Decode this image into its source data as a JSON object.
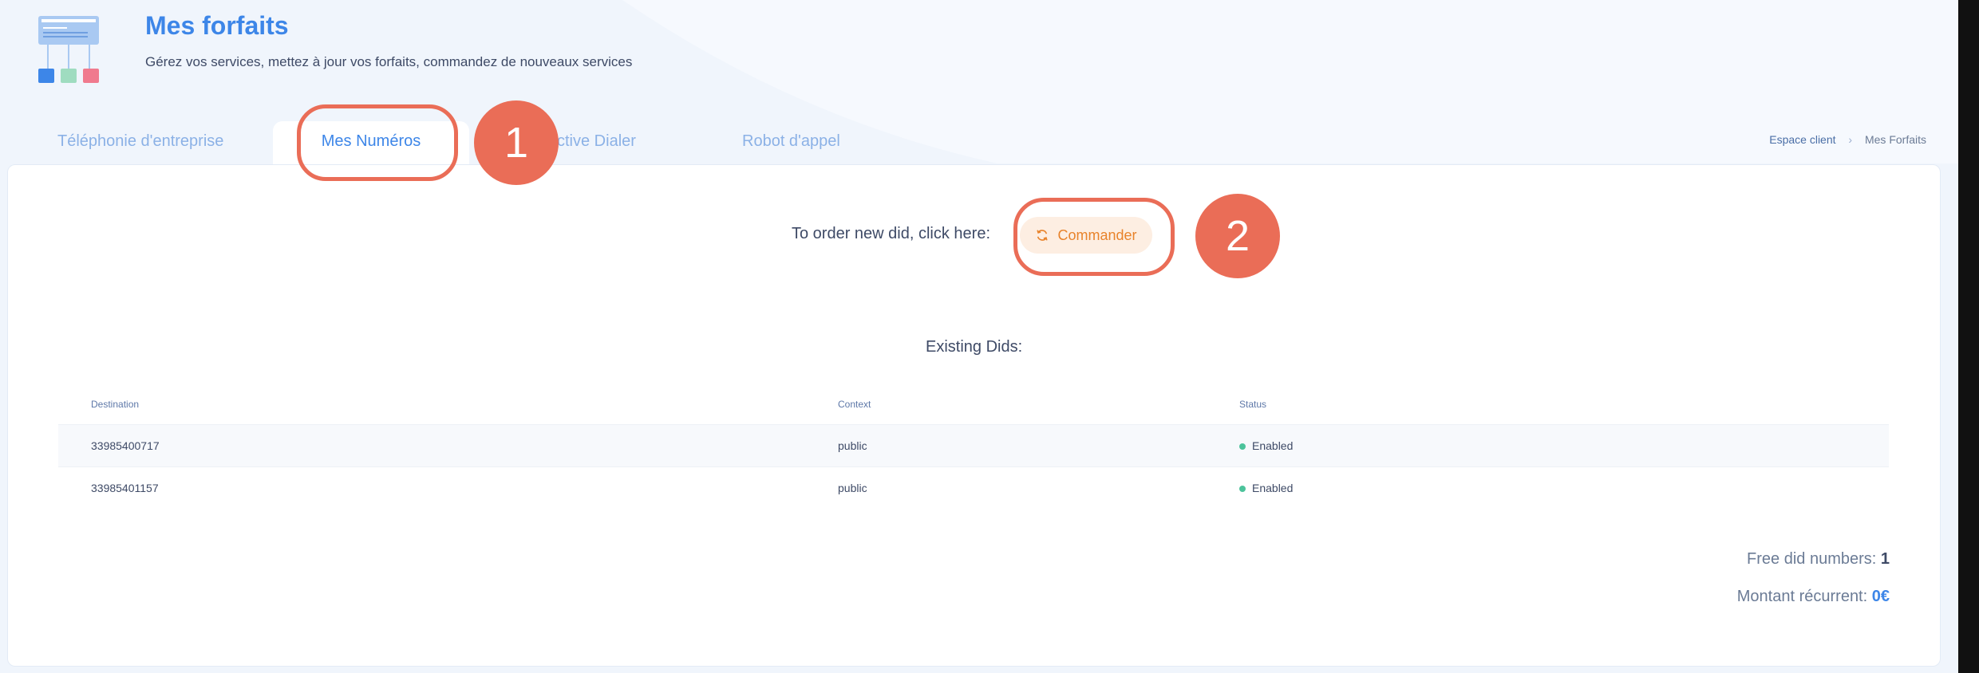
{
  "header": {
    "title": "Mes forfaits",
    "subtitle": "Gérez vos services, mettez à jour vos forfaits, commandez de nouveaux services"
  },
  "tabs": [
    {
      "label": "Téléphonie d'entreprise",
      "active": false
    },
    {
      "label": "Mes Numéros",
      "active": true
    },
    {
      "label": "Predictive Dialer",
      "active": false
    },
    {
      "label": "Robot d'appel",
      "active": false
    }
  ],
  "tab_partial_label": "ctive Dialer",
  "breadcrumb": {
    "home": "Espace client",
    "separator": "›",
    "current": "Mes Forfaits"
  },
  "order": {
    "prompt": "To order new did, click here:",
    "button_label": "Commander"
  },
  "existing_title": "Existing Dids:",
  "table": {
    "headers": [
      "Destination",
      "Context",
      "Status"
    ],
    "rows": [
      {
        "destination": "33985400717",
        "context": "public",
        "status": "Enabled"
      },
      {
        "destination": "33985401157",
        "context": "public",
        "status": "Enabled"
      }
    ]
  },
  "summary": {
    "free_label": "Free did numbers:",
    "free_value": "1",
    "recurring_label": "Montant récurrent:",
    "recurring_value": "0€"
  },
  "annotations": {
    "badge1": "1",
    "badge2": "2"
  },
  "colors": {
    "accent": "#3d86e8",
    "annotation": "#ea6d57",
    "order_button_bg": "#fdeee2",
    "order_button_text": "#e8832b",
    "status_enabled": "#4cc39b"
  }
}
